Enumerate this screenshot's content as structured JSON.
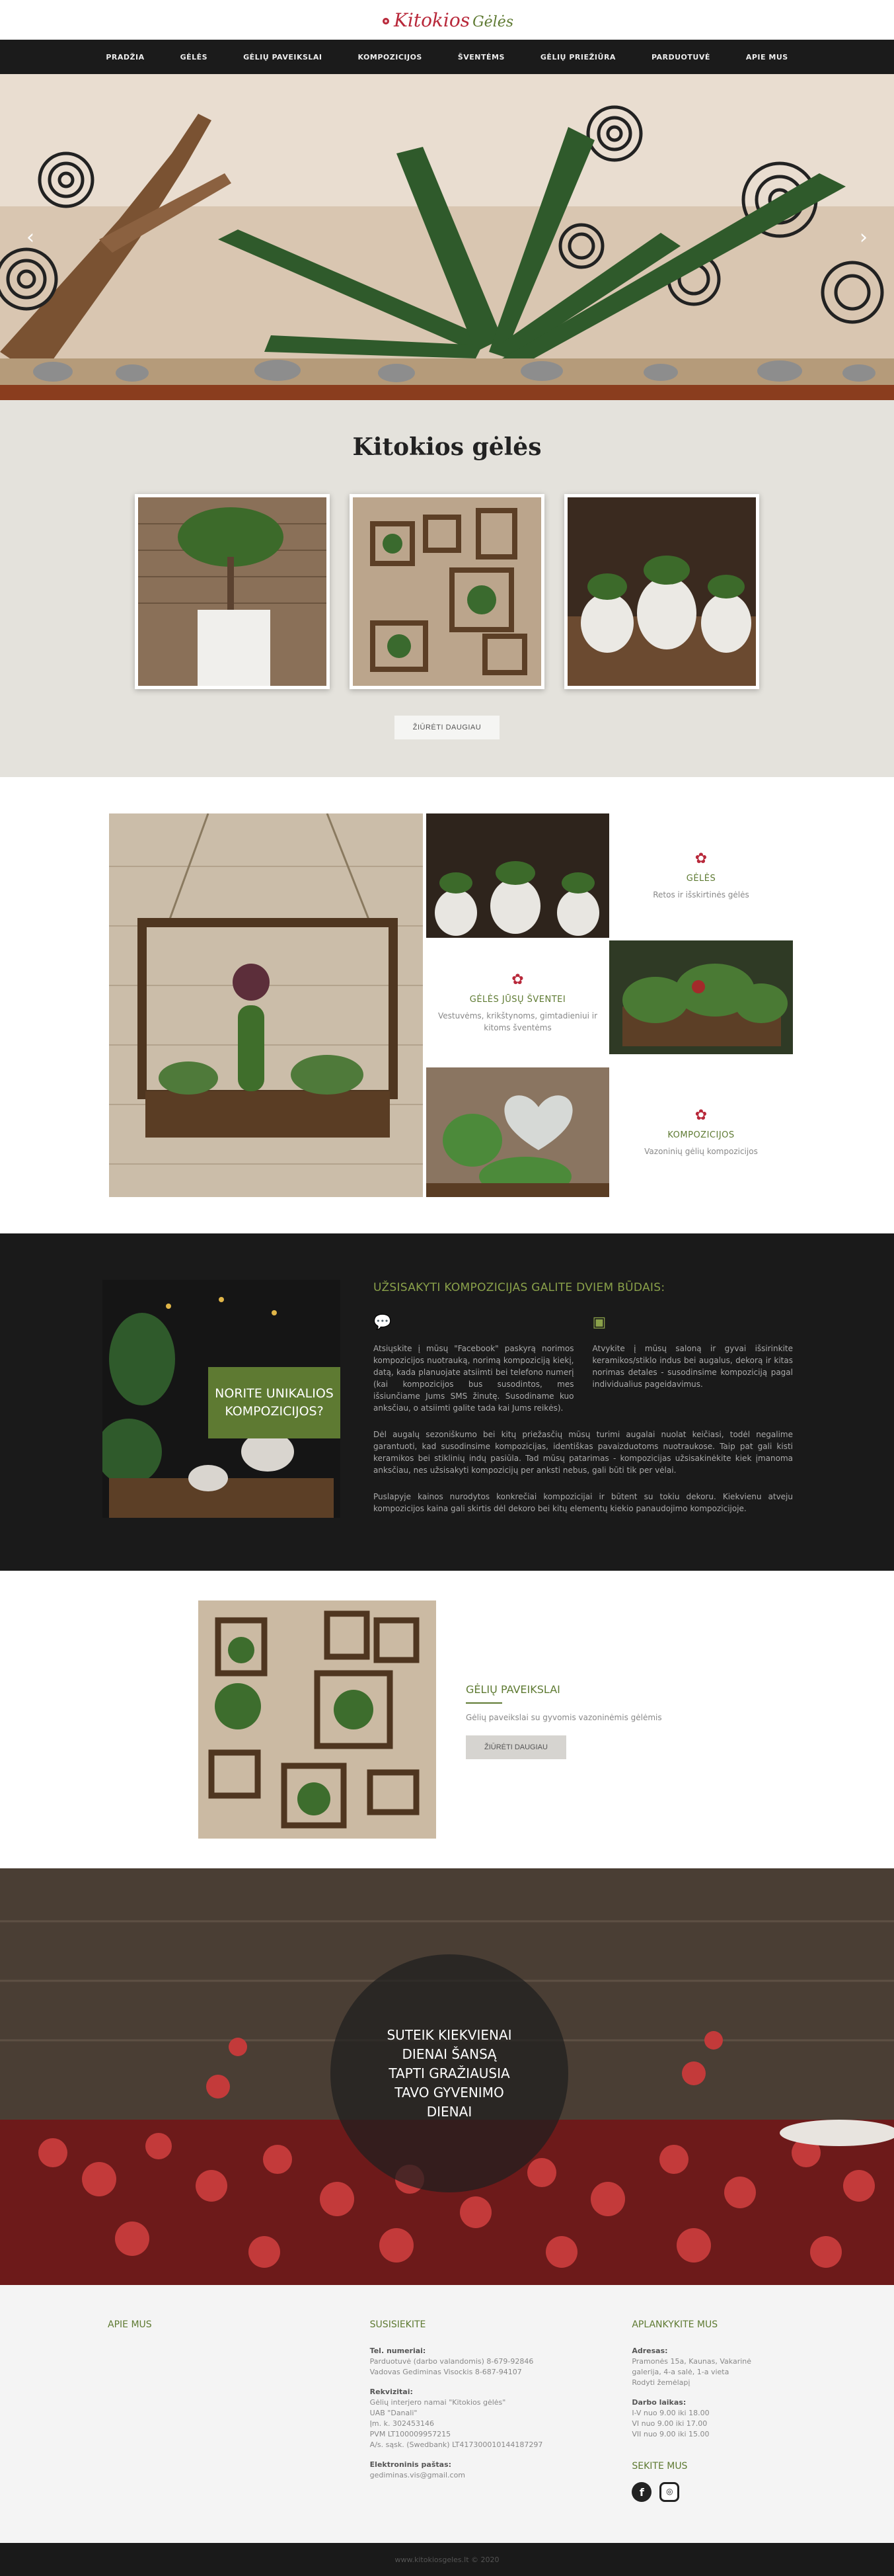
{
  "logo": {
    "main": "Kitokios",
    "sub": "Gėlės"
  },
  "nav": [
    "PRADŽIA",
    "GĖLĖS",
    "GĖLIŲ PAVEIKSLAI",
    "KOMPOZICIJOS",
    "ŠVENTĖMS",
    "GĖLIŲ PRIEŽIŪRA",
    "PARDUOTUVĖ",
    "APIE MUS"
  ],
  "hero": {
    "prev_icon": "chevron-left-icon",
    "next_icon": "chevron-right-icon"
  },
  "section1": {
    "title": "Kitokios gėlės",
    "button": "ŽIŪRĖTI DAUGIAU"
  },
  "mosaic": {
    "geles": {
      "title": "GĖLĖS",
      "desc": "Retos ir išskirtinės gėlės"
    },
    "sventems": {
      "title": "GĖLĖS JŪSŲ ŠVENTEI",
      "desc": "Vestuvėms, krikštynoms, gimtadieniui ir kitoms šventėms"
    },
    "kompozicijos": {
      "title": "KOMPOZICIJOS",
      "desc": "Vazoninių gėlių kompozicijos"
    }
  },
  "dark": {
    "image_label": "NORITE UNIKALIOS KOMPOZICIJOS?",
    "title": "UŽSISAKYTI KOMPOZICIJAS GALITE DVIEM BŪDAIS:",
    "col1": "Atsiųskite į mūsų \"Facebook\" paskyrą norimos kompozicijos nuotrauką, norimą kompoziciją kiekį, datą, kada planuojate atsiimti bei telefono numerį (kai kompozicijos bus susodintos, mes išsiunčiame Jums SMS žinutę. Susodiname kuo anksčiau, o atsiimti galite tada kai Jums reikės).",
    "col2": "Atvykite į mūsų saloną ir gyvai išsirinkite keramikos/stiklo indus bei augalus, dekorą ir kitas norimas detales - susodinsime kompoziciją pagal individualius pageidavimus.",
    "para1": "Dėl augalų sezoniškumo bei kitų priežasčių mūsų turimi augalai nuolat keičiasi, todėl negalime garantuoti, kad susodinsime kompozicijas, identiškas pavaizduotoms nuotraukose. Taip pat gali kisti keramikos bei stiklinių indų pasiūla. Tad mūsų patarimas - kompozicijas užsisakinėkite kiek įmanoma anksčiau, nes užsisakyti kompozicijų per anksti nebus, gali būti tik per vėlai.",
    "para2": "Puslapyje kainos nurodytos konkrečiai kompozicijai ir būtent su tokiu dekoru. Kiekvienu atveju kompozicijos kaina gali skirtis dėl dekoro bei kitų elementų kiekio panaudojimo kompozicijoje."
  },
  "paintings": {
    "title": "GĖLIŲ PAVEIKSLAI",
    "desc": "Gėlių paveikslai su gyvomis vazoninėmis gėlėmis",
    "button": "ŽIŪRĖTI DAUGIAU"
  },
  "banner": {
    "text": "SUTEIK KIEKVIENAI DIENAI ŠANSĄ TAPTI GRAŽIAUSIA TAVO GYVENIMO DIENAI"
  },
  "footer": {
    "about_title": "APIE MUS",
    "contact_title": "SUSISIEKITE",
    "tel_label": "Tel. numeriai:",
    "tel1": "Parduotuvė (darbo valandomis) 8-679-92846",
    "tel2": "Vadovas Gediminas Visockis 8-687-94107",
    "req_label": "Rekvizitai:",
    "req1": "Gėlių interjero namai \"Kitokios gėlės\"",
    "req2": "UAB \"Danali\"",
    "req3": "Įm. k. 302453146",
    "req4": "PVM LT100009957215",
    "req5": "A/s. sąsk. (Swedbank) LT417300010144187297",
    "email_label": "Elektroninis paštas:",
    "email": "gediminas.vis@gmail.com",
    "visit_title": "APLANKYKITE MUS",
    "addr_label": "Adresas:",
    "addr1": "Pramonės 15a, Kaunas, Vakarinė",
    "addr2": "galerija, 4-a salė, 1-a vieta",
    "addr3": "Rodyti žemėlapį",
    "hours_label": "Darbo laikas:",
    "hours1": "I-V nuo 9.00 iki 18.00",
    "hours2": "VI nuo 9.00 iki 17.00",
    "hours3": "VII nuo 9.00 iki 15.00",
    "follow_title": "SEKITE MUS",
    "fb_icon": "f",
    "ig_icon": "◎",
    "copyright": "www.kitokiosgeles.lt © 2020"
  },
  "colors": {
    "accent_green": "#5e7a32",
    "accent_red": "#b8283a",
    "dark": "#1a1a1a",
    "grey_section": "#e4e2dc"
  }
}
